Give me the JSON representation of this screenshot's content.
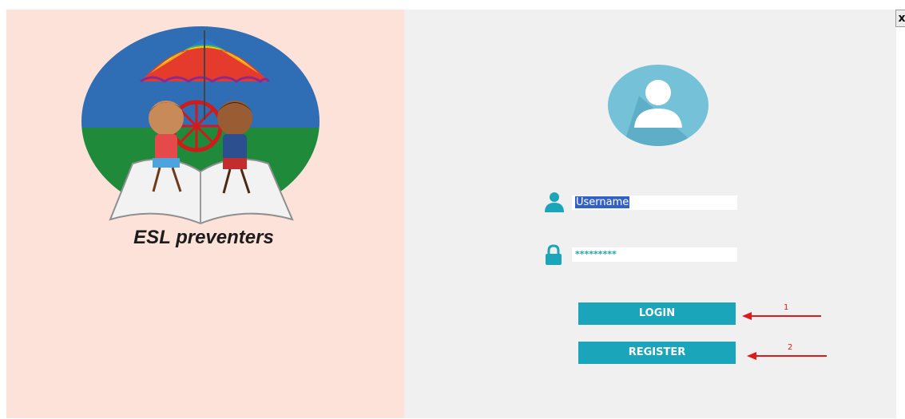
{
  "app": {
    "brand_name": "ESL preventers",
    "close_label": "x"
  },
  "login_form": {
    "username_value": "Username",
    "password_value": "*********",
    "login_label": "LOGIN",
    "register_label": "REGISTER"
  },
  "annotations": {
    "marker_1": "1",
    "marker_2": "2"
  },
  "colors": {
    "left_panel_bg": "#fde2d9",
    "right_panel_bg": "#f0f0f0",
    "accent": "#1aa5ba",
    "annotation": "#e01a1a"
  },
  "icons": [
    "user-avatar-icon",
    "user-icon",
    "lock-icon",
    "close-icon"
  ]
}
